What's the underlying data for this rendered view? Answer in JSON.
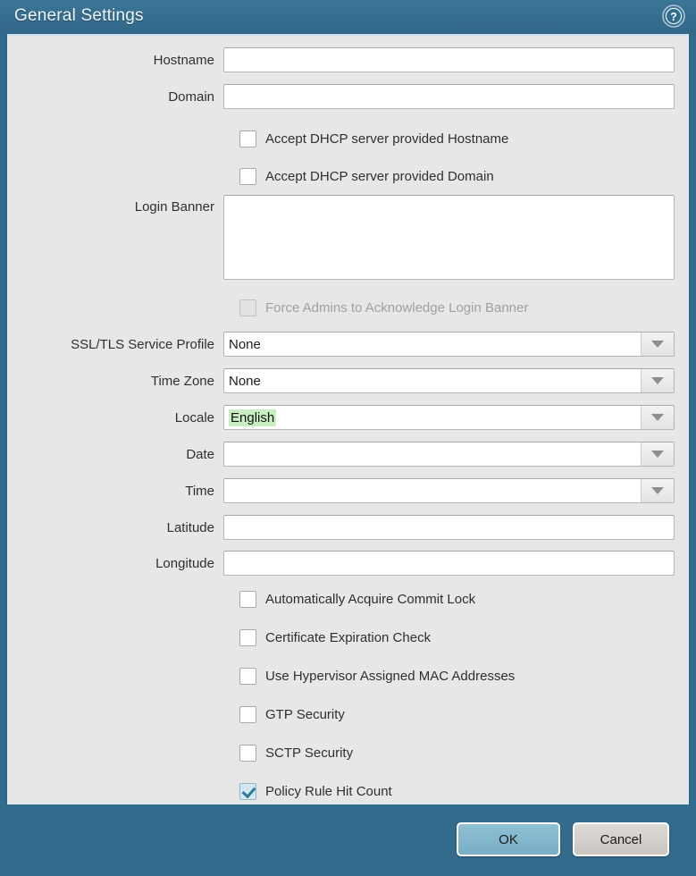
{
  "dialog": {
    "title": "General Settings",
    "help_icon": "help-circle-icon",
    "frame_color": "#336b8c",
    "panel_color": "#e7e7e7",
    "accent_color": "#79aec5",
    "highlight_color": "#c9eec2"
  },
  "fields": {
    "hostname": {
      "label": "Hostname",
      "value": "",
      "placeholder": ""
    },
    "domain": {
      "label": "Domain",
      "value": "",
      "placeholder": ""
    },
    "login_banner": {
      "label": "Login Banner",
      "value": "",
      "placeholder": ""
    },
    "ssl_tls_service_profile": {
      "label": "SSL/TLS Service Profile",
      "value": "None"
    },
    "time_zone": {
      "label": "Time Zone",
      "value": "None"
    },
    "locale": {
      "label": "Locale",
      "value": "English"
    },
    "date": {
      "label": "Date",
      "value": ""
    },
    "time": {
      "label": "Time",
      "value": ""
    },
    "latitude": {
      "label": "Latitude",
      "value": "",
      "placeholder": ""
    },
    "longitude": {
      "label": "Longitude",
      "value": "",
      "placeholder": ""
    }
  },
  "checkboxes": {
    "accept_dhcp_hostname": {
      "label": "Accept DHCP server provided Hostname",
      "checked": false,
      "disabled": false
    },
    "accept_dhcp_domain": {
      "label": "Accept DHCP server provided Domain",
      "checked": false,
      "disabled": false
    },
    "force_ack_banner": {
      "label": "Force Admins to Acknowledge Login Banner",
      "checked": false,
      "disabled": true
    },
    "auto_commit_lock": {
      "label": "Automatically Acquire Commit Lock",
      "checked": false,
      "disabled": false
    },
    "cert_expiration_check": {
      "label": "Certificate Expiration Check",
      "checked": false,
      "disabled": false
    },
    "hypervisor_mac": {
      "label": "Use Hypervisor Assigned MAC Addresses",
      "checked": false,
      "disabled": false
    },
    "gtp_security": {
      "label": "GTP Security",
      "checked": false,
      "disabled": false
    },
    "sctp_security": {
      "label": "SCTP Security",
      "checked": false,
      "disabled": false
    },
    "policy_rule_hit_count": {
      "label": "Policy Rule Hit Count",
      "checked": true,
      "disabled": false
    }
  },
  "footer": {
    "ok_label": "OK",
    "cancel_label": "Cancel"
  }
}
